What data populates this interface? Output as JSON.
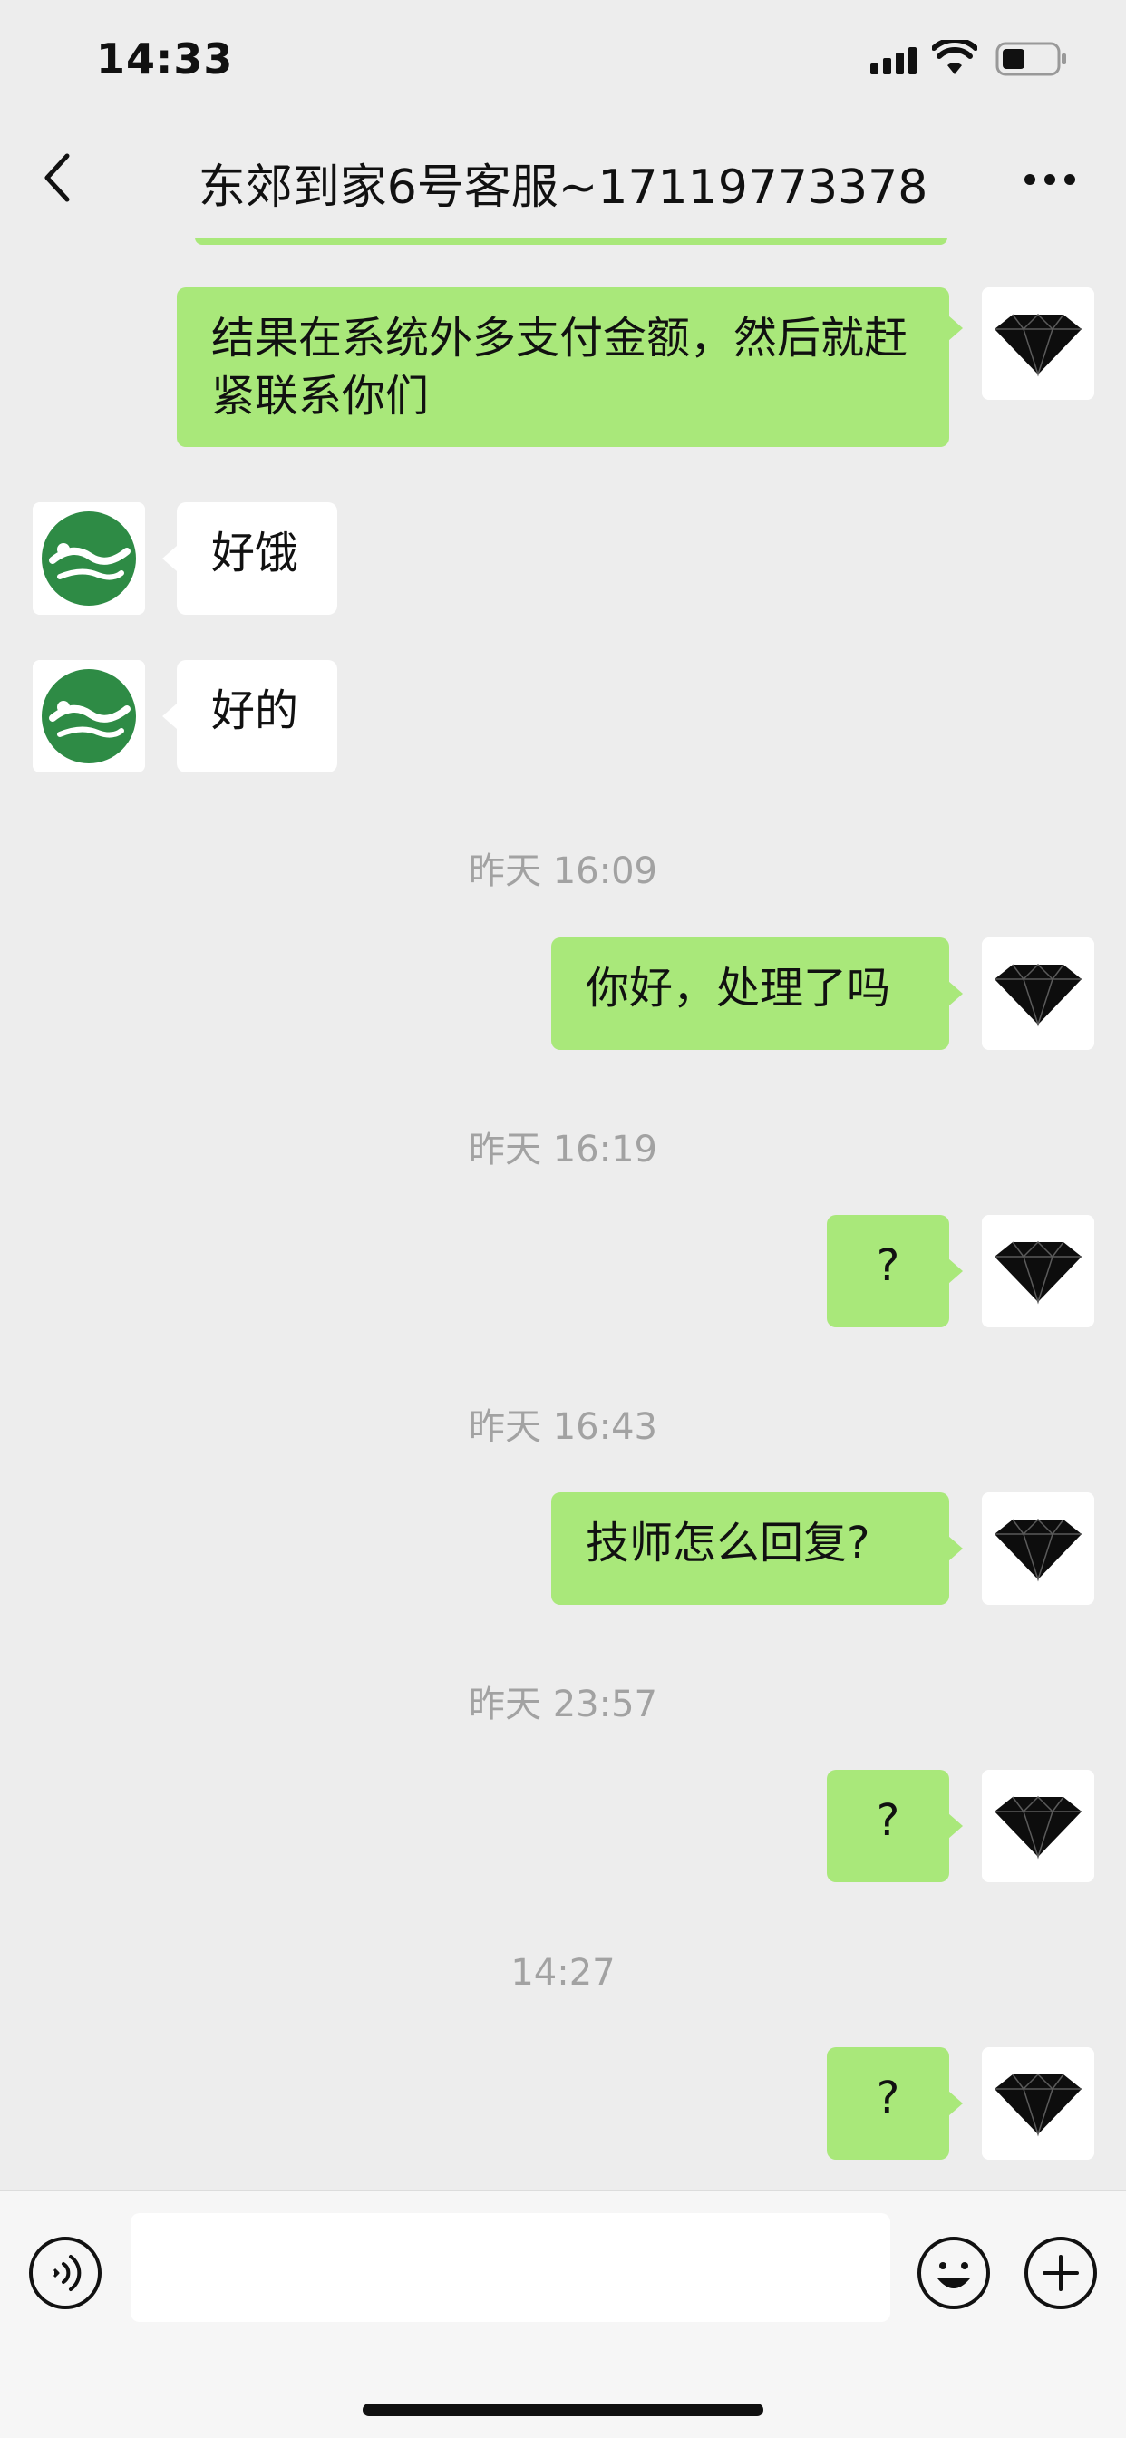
{
  "status_bar": {
    "time": "14:33"
  },
  "header": {
    "title": "东郊到家6号客服~17119773378"
  },
  "messages": [
    {
      "type": "out",
      "text": "结果在系统外多支付金额，然后就赶紧联系你们"
    },
    {
      "type": "in",
      "text": "好饿"
    },
    {
      "type": "in",
      "text": "好的"
    },
    {
      "type": "time",
      "text": "昨天 16:09"
    },
    {
      "type": "out",
      "text": "你好，处理了吗"
    },
    {
      "type": "time",
      "text": "昨天 16:19"
    },
    {
      "type": "out",
      "text": "?"
    },
    {
      "type": "time",
      "text": "昨天 16:43"
    },
    {
      "type": "out",
      "text": "技师怎么回复?"
    },
    {
      "type": "time",
      "text": "昨天 23:57"
    },
    {
      "type": "out",
      "text": "?"
    },
    {
      "type": "time",
      "text": "14:27"
    },
    {
      "type": "out",
      "text": "?"
    }
  ],
  "colors": {
    "outgoing_bubble": "#a9e87a",
    "incoming_bubble": "#ffffff",
    "background": "#ededed"
  },
  "icons": [
    "back-icon",
    "more-icon",
    "voice-icon",
    "emoji-icon",
    "plus-icon"
  ]
}
